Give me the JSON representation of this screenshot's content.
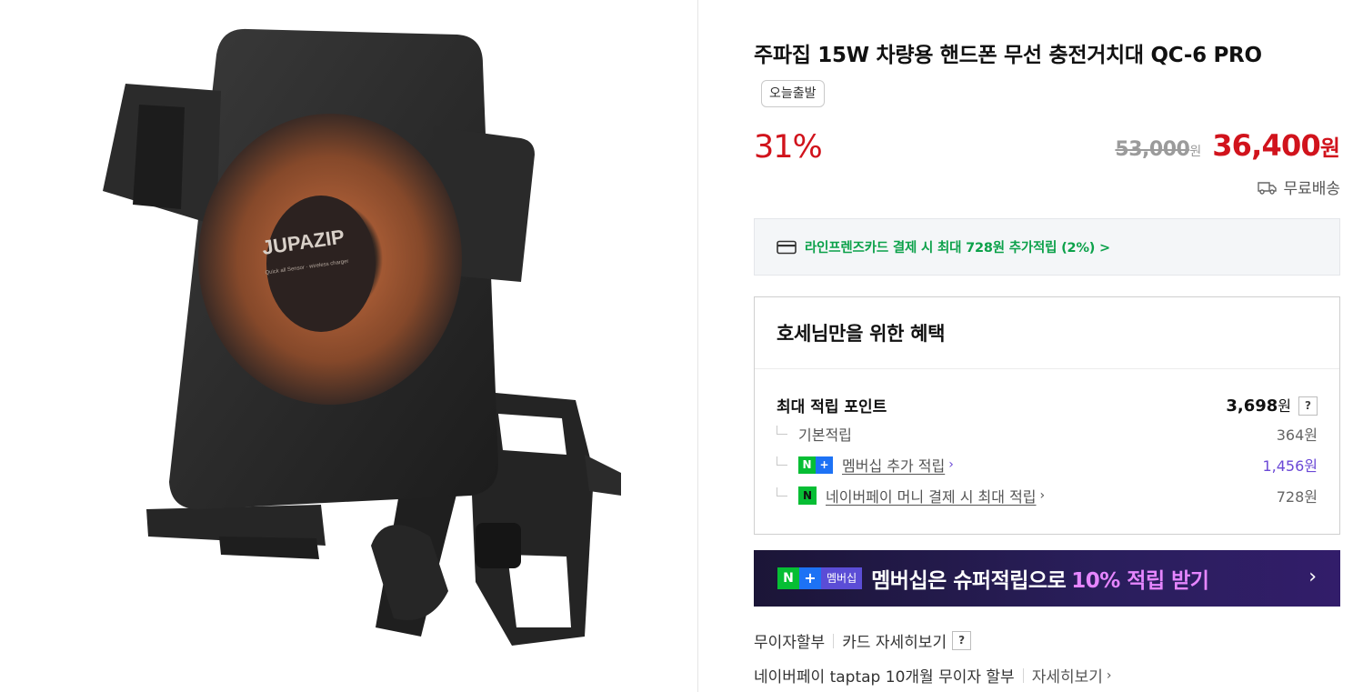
{
  "product": {
    "title": "주파집 15W 차량용 핸드폰 무선 충전거치대 QC-6 PRO",
    "badge": "오늘출발",
    "discount": "31%",
    "original_price": "53,000",
    "original_unit": "원",
    "sale_price": "36,400",
    "sale_unit": "원",
    "shipping": "무료배송",
    "image_brand": "JUPAZIP",
    "image_brand_sub": "Quick all Sensor · wireless charger"
  },
  "card_banner": {
    "text": "라인프렌즈카드 결제 시 최대 728원 추가적립 (2%) >"
  },
  "benefit": {
    "title": "호세님만을 위한 혜택",
    "max_label": "최대 적립 포인트",
    "max_value": "3,698",
    "max_unit": "원",
    "help": "?",
    "rows": [
      {
        "label": "기본적립",
        "value": "364원"
      },
      {
        "label": "멤버십 추가 적립",
        "value": "1,456원"
      },
      {
        "label": "네이버페이 머니 결제 시 최대 적립",
        "value": "728원"
      }
    ]
  },
  "membership_banner": {
    "badge_n": "N",
    "badge_plus": "+",
    "badge_text": "멤버십",
    "text": "멤버십은 슈퍼적립으로",
    "accent": "10% 적립 받기",
    "arrow": "›"
  },
  "installment": {
    "label": "무이자할부",
    "card_detail": "카드 자세히보기",
    "help": "?",
    "taptap": "네이버페이 taptap 10개월 무이자 할부",
    "taptap_detail": "자세히보기"
  },
  "colors": {
    "sale_red": "#d1131c",
    "naver_green": "#06be34",
    "membership_purple": "#6b49d6",
    "banner_bg": "#2a1e5c"
  },
  "icons": [
    "truck-icon",
    "card-icon",
    "chevron-right-icon",
    "question-icon",
    "npay-icon",
    "nplus-icon"
  ]
}
